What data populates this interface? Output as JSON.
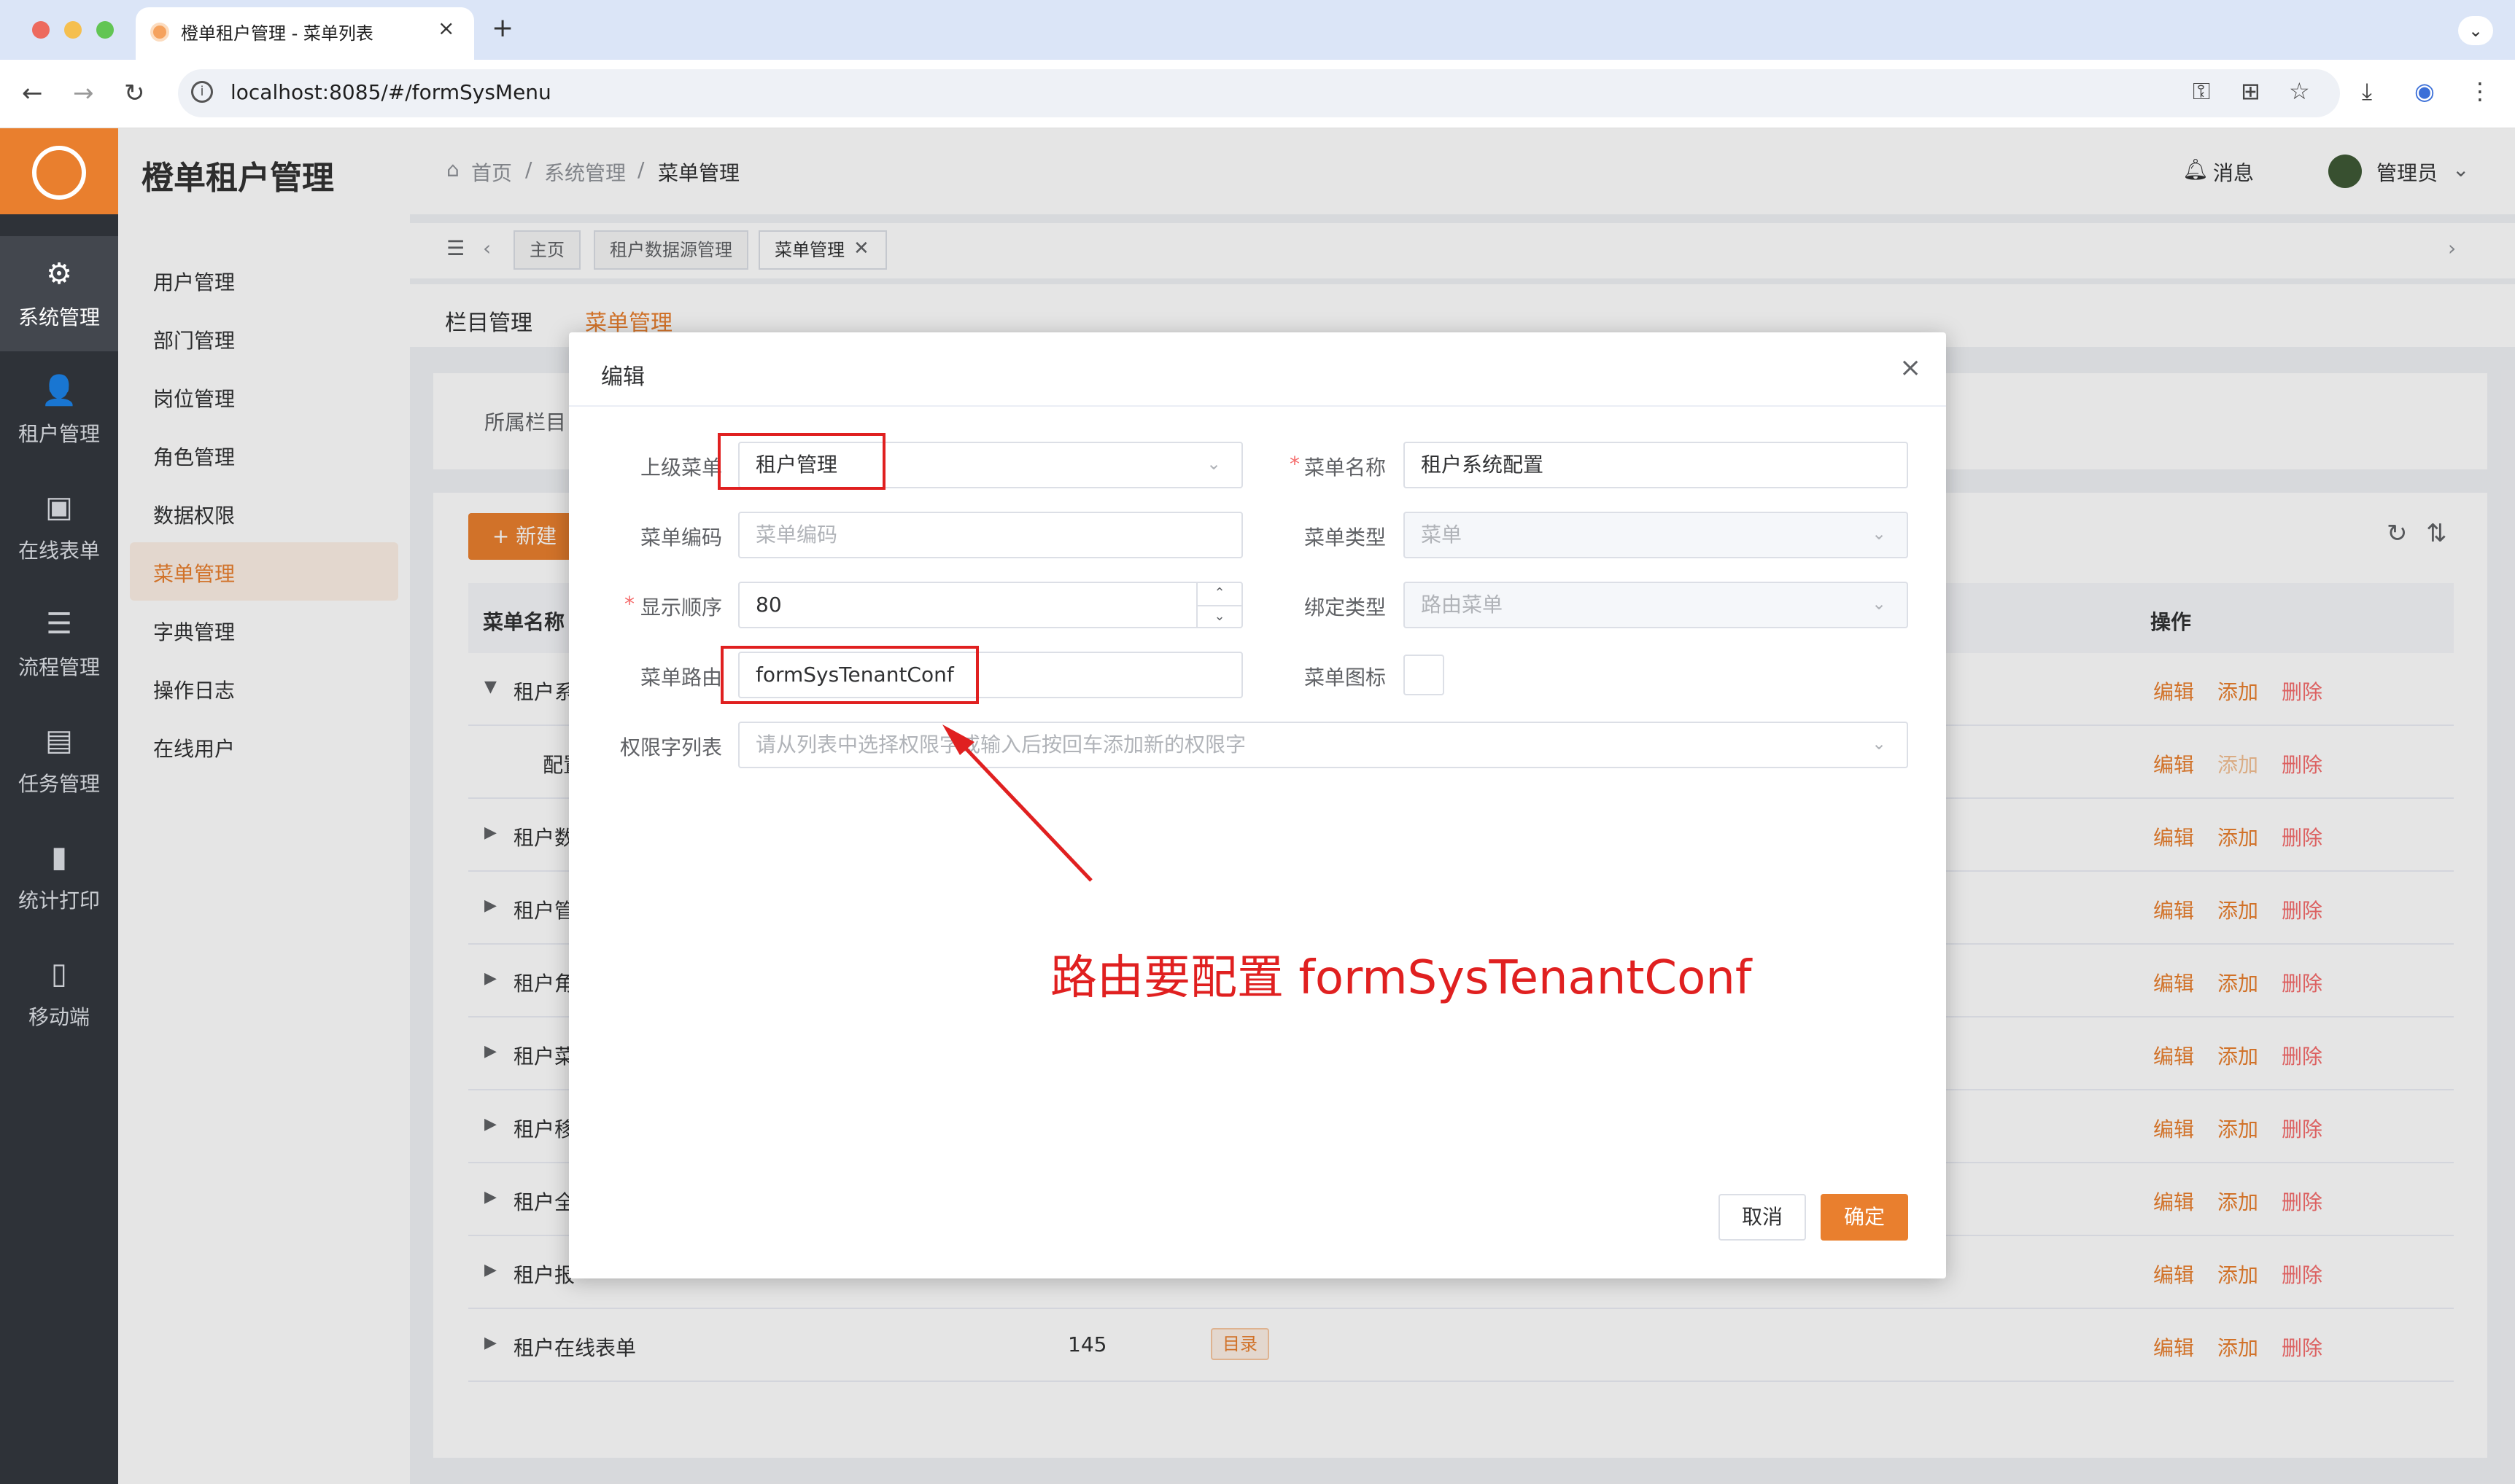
{
  "browser": {
    "tab_title": "橙单租户管理 - 菜单列表",
    "tab_close": "×",
    "new_tab": "+",
    "tab_menu": "⌄",
    "url": "localhost:8085/#/formSysMenu"
  },
  "app": {
    "brand": "橙单租户管理",
    "breadcrumb": [
      "首页",
      "系统管理",
      "菜单管理"
    ],
    "breadcrumb_sep": "/",
    "messages": "消息",
    "user": "管理员"
  },
  "sidebar": [
    {
      "label": "系统管理",
      "icon": "⚙"
    },
    {
      "label": "租户管理",
      "icon": "👤"
    },
    {
      "label": "在线表单",
      "icon": "▣"
    },
    {
      "label": "流程管理",
      "icon": "☰"
    },
    {
      "label": "任务管理",
      "icon": "▤"
    },
    {
      "label": "统计打印",
      "icon": "▮"
    },
    {
      "label": "移动端",
      "icon": "▯"
    }
  ],
  "menu": [
    "用户管理",
    "部门管理",
    "岗位管理",
    "角色管理",
    "数据权限",
    "菜单管理",
    "字典管理",
    "操作日志",
    "在线用户"
  ],
  "tags": [
    "主页",
    "租户数据源管理",
    "菜单管理"
  ],
  "subtabs": [
    "栏目管理",
    "菜单管理"
  ],
  "filter_label": "所属栏目",
  "new_button": "+ 新建",
  "table": {
    "col_name": "菜单名称",
    "col_ops": "操作",
    "rows": [
      {
        "name": "租户系",
        "arrow": "▼"
      },
      {
        "name": "配置",
        "arrow": ""
      },
      {
        "name": "租户数",
        "arrow": "▶"
      },
      {
        "name": "租户管",
        "arrow": "▶"
      },
      {
        "name": "租户角",
        "arrow": "▶"
      },
      {
        "name": "租户菜",
        "arrow": "▶"
      },
      {
        "name": "租户移",
        "arrow": "▶"
      },
      {
        "name": "租户全",
        "arrow": "▶"
      },
      {
        "name": "租户报",
        "arrow": "▶"
      },
      {
        "name": "租户在线表单",
        "arrow": "▶",
        "order": "145",
        "badge": "目录"
      }
    ],
    "ops": {
      "edit": "编辑",
      "add": "添加",
      "del": "删除"
    }
  },
  "dialog": {
    "title": "编辑",
    "close": "×",
    "parent_label": "上级菜单",
    "parent_value": "租户管理",
    "name_label": "菜单名称",
    "name_value": "租户系统配置",
    "code_label": "菜单编码",
    "code_placeholder": "菜单编码",
    "type_label": "菜单类型",
    "type_value": "菜单",
    "order_label": "显示顺序",
    "order_value": "80",
    "bind_label": "绑定类型",
    "bind_value": "路由菜单",
    "route_label": "菜单路由",
    "route_value": "formSysTenantConf",
    "icon_label": "菜单图标",
    "perm_label": "权限字列表",
    "perm_placeholder": "请从列表中选择权限字或输入后按回车添加新的权限字",
    "required_mark": "*",
    "cancel": "取消",
    "ok": "确定"
  },
  "annotation": "路由要配置 formSysTenantConf"
}
